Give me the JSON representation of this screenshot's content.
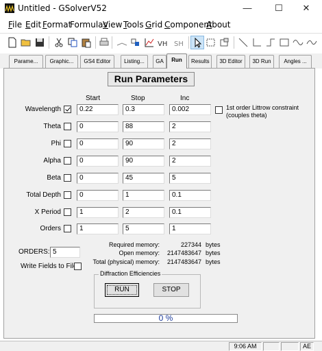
{
  "window": {
    "title": "Untitled - GSolverV52",
    "minimize": "—",
    "maximize": "☐",
    "close": "✕"
  },
  "menu": {
    "items": [
      {
        "key": "F",
        "rest": "ile"
      },
      {
        "key": "E",
        "rest": "dit"
      },
      {
        "key": "F",
        "rest": "ormat"
      },
      {
        "key": "",
        "rest": "Formulas"
      },
      {
        "key": "V",
        "rest": "iew"
      },
      {
        "key": "T",
        "rest": "ools"
      },
      {
        "key": "G",
        "rest": "rid"
      },
      {
        "key": "C",
        "rest": "omponent"
      },
      {
        "key": "A",
        "rest": "bout"
      }
    ]
  },
  "toolbar": {
    "icons": [
      "new-file-icon",
      "open-folder-icon",
      "save-icon",
      "cut-icon",
      "copy-icon",
      "paste-icon",
      "print-icon",
      "layer-icon",
      "add-layer-icon",
      "graph-icon",
      "vh-icon",
      "sh-icon",
      "pointer-icon",
      "zoom-region-icon",
      "component-icon",
      "line-icon",
      "step-icon",
      "rectangle-icon",
      "sine-icon",
      "arc-icon"
    ]
  },
  "tabs": [
    {
      "label": "Parame..."
    },
    {
      "label": "Graphic..."
    },
    {
      "label": "GS4 Editor"
    },
    {
      "label": "Listing..."
    },
    {
      "label": "GA"
    },
    {
      "label": "Run"
    },
    {
      "label": "Results"
    },
    {
      "label": "3D Editor"
    },
    {
      "label": "3D Run"
    },
    {
      "label": "Angles ..."
    }
  ],
  "panel": {
    "heading": "Run Parameters",
    "columns": {
      "start": "Start",
      "stop": "Stop",
      "inc": "Inc"
    },
    "rows": [
      {
        "label": "Wavelength",
        "checked": true,
        "start": "0.22",
        "stop": "0.3",
        "inc": "0.002"
      },
      {
        "label": "Theta",
        "checked": false,
        "start": "0",
        "stop": "88",
        "inc": "2"
      },
      {
        "label": "Phi",
        "checked": false,
        "start": "0",
        "stop": "90",
        "inc": "2"
      },
      {
        "label": "Alpha",
        "checked": false,
        "start": "0",
        "stop": "90",
        "inc": "2"
      },
      {
        "label": "Beta",
        "checked": false,
        "start": "0",
        "stop": "45",
        "inc": "5"
      },
      {
        "label": "Total Depth",
        "checked": false,
        "start": "0",
        "stop": "1",
        "inc": "0.1"
      },
      {
        "label": "X Period",
        "checked": false,
        "start": "1",
        "stop": "2",
        "inc": "0.1"
      },
      {
        "label": "Orders",
        "checked": false,
        "start": "1",
        "stop": "5",
        "inc": "1"
      }
    ],
    "littrow": {
      "line1": "1st order Littrow constraint",
      "line2": "(couples theta)",
      "checked": false
    },
    "orders": {
      "label": "ORDERS:",
      "value": "5"
    },
    "write_fields": {
      "label": "Write Fields to File",
      "checked": false
    },
    "memory": {
      "required": {
        "label": "Required memory:",
        "value": "227344",
        "unit": "bytes"
      },
      "open": {
        "label": "Open memory:",
        "value": "2147483647",
        "unit": "bytes"
      },
      "total": {
        "label": "Total (physical) memory:",
        "value": "2147483647",
        "unit": "bytes"
      }
    },
    "diffraction": {
      "label": "Diffraction Efficiencies",
      "run": "RUN",
      "stop": "STOP"
    },
    "progress": {
      "text": "0 %",
      "fraction": 0
    }
  },
  "status": {
    "time": "9:06 AM",
    "cell2": "",
    "cell3": "",
    "cell4": "AE"
  }
}
